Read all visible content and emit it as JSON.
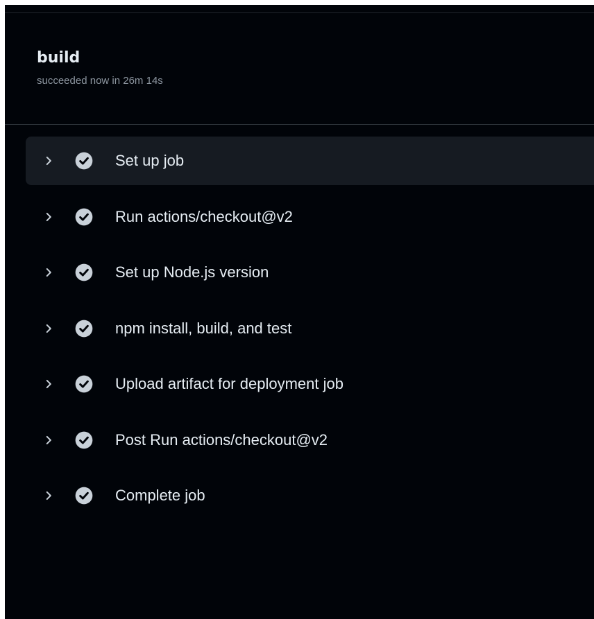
{
  "job": {
    "name": "build",
    "status_text": "succeeded now in 26m 14s"
  },
  "steps": [
    {
      "label": "Set up job",
      "status": "success",
      "active": true
    },
    {
      "label": "Run actions/checkout@v2",
      "status": "success",
      "active": false
    },
    {
      "label": "Set up Node.js version",
      "status": "success",
      "active": false
    },
    {
      "label": "npm install, build, and test",
      "status": "success",
      "active": false
    },
    {
      "label": "Upload artifact for deployment job",
      "status": "success",
      "active": false
    },
    {
      "label": "Post Run actions/checkout@v2",
      "status": "success",
      "active": false
    },
    {
      "label": "Complete job",
      "status": "success",
      "active": false
    }
  ],
  "icons": {
    "expand": "chevron-right-icon",
    "status": "check-circle-fill-icon"
  },
  "colors": {
    "background": "#010409",
    "active_row": "#161b22",
    "text_primary": "#e6edf3",
    "text_muted": "#8d96a0",
    "icon": "#c9d1d9"
  }
}
